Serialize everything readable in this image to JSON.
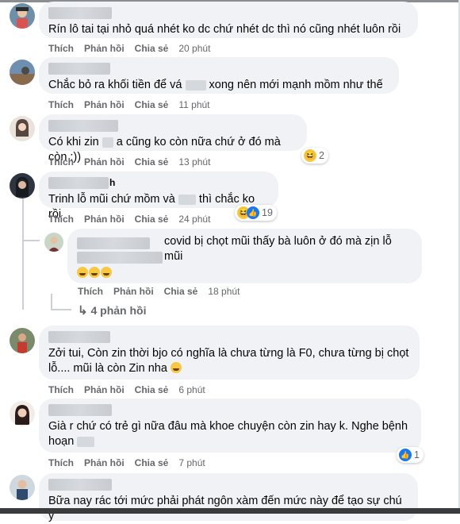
{
  "actions": {
    "like": "Thích",
    "reply": "Phản hồi",
    "share": "Chia sẻ"
  },
  "comments": [
    {
      "text": "Rín lô tai tại nhỏ quá nhét ko dc chứ nhét dc thì nó cũng nhét luôn rồi",
      "time": "20 phút"
    },
    {
      "text_a": "Chắc bỏ ra khối tiền để vá",
      "text_b": "xong nên mới mạnh mồm như thế",
      "time": "11 phút"
    },
    {
      "text_a": "Có khi zin",
      "text_b": "a cũng ko còn nữa chứ ở đó mà còn :))",
      "time": "13 phút",
      "reaction_count": "2"
    },
    {
      "name_suffix": "h",
      "text_a": "Trinh lỗ mũi chứ mồm và",
      "text_b": "thì chắc ko rồi",
      "time": "24 phút",
      "reaction_count": "19",
      "reply": {
        "text": "covid bị chọt mũi thấy bà luôn ở đó mà zịn lỗ mũi",
        "time": "18 phút"
      },
      "more_replies": "4 phản hồi"
    },
    {
      "text_line1": "Zởi tui, Còn zin thời bjo có nghĩa là chưa từng là F0, chưa từng bị chọt",
      "text_line2": "lỗ.... mũi là còn Zin nha",
      "time": "6 phút"
    },
    {
      "text_line1": "Già r chứ có trẻ gì nữa đâu mà khoe chuyện còn zin hay k. Nghe bệnh",
      "text_line2": "hoạn",
      "time": "7 phút",
      "reaction_count": "1"
    },
    {
      "text": "Bữa nay rác tới mức phải phát ngôn xàm đến mức này để tạo sự chú ý"
    }
  ],
  "icons": [
    "haha-icon",
    "like-icon",
    "reply-arrow-icon"
  ],
  "colors": {
    "bubble": "#f0f2f5",
    "meta": "#65676b",
    "like_blue": "#1877f2",
    "haha_yellow": "#f7c844"
  }
}
